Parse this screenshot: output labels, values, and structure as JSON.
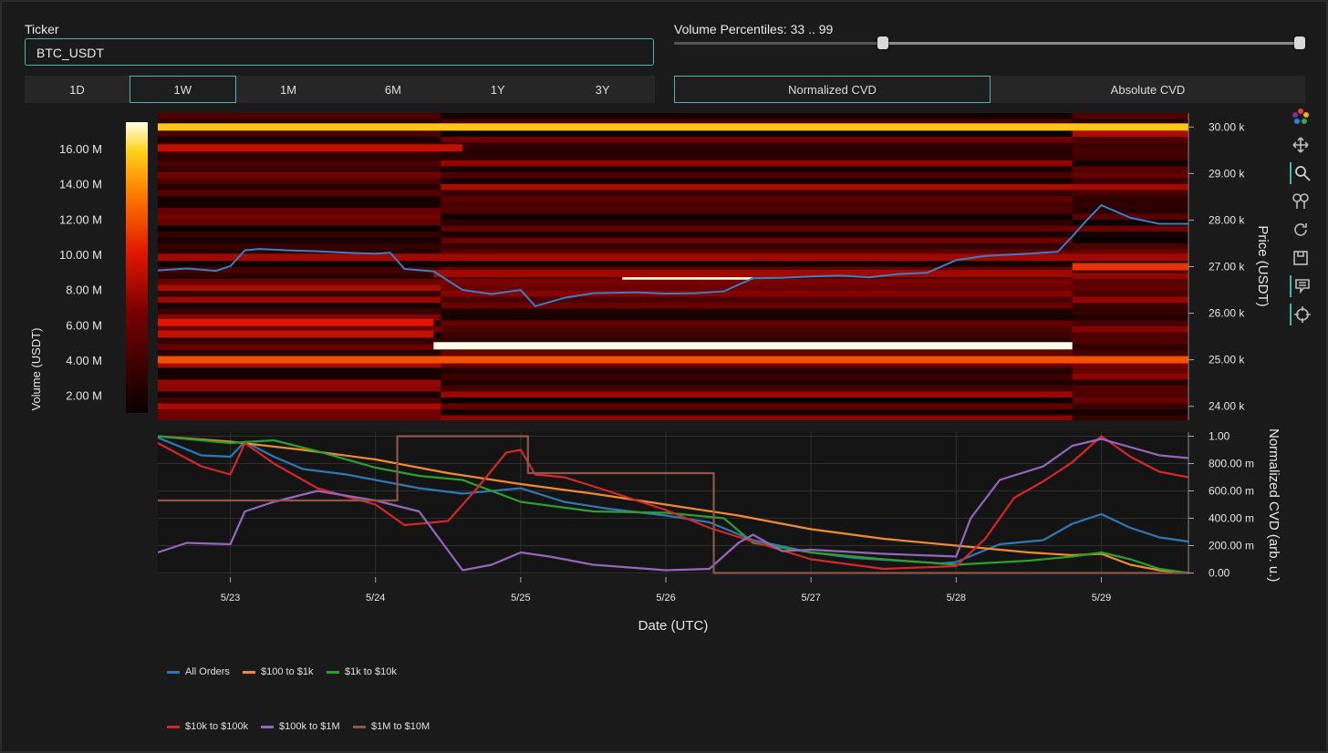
{
  "controls": {
    "ticker_label": "Ticker",
    "ticker_value": "BTC_USDT",
    "timeframes": [
      "1D",
      "1W",
      "1M",
      "6M",
      "1Y",
      "3Y"
    ],
    "active_timeframe": "1W",
    "volume_percentiles_label": "Volume Percentiles: 33 .. 99",
    "volume_percentiles_range": [
      33,
      99
    ],
    "cvd_modes": [
      "Normalized CVD",
      "Absolute CVD"
    ],
    "active_cvd_mode": "Normalized CVD"
  },
  "modebar": {
    "icons": [
      "plotly-logo-icon",
      "pan-icon",
      "zoom-icon",
      "zoom-in-out-icon",
      "reset-axes-icon",
      "download-icon",
      "hover-compare-icon",
      "spike-lines-icon"
    ]
  },
  "chart_data": [
    {
      "type": "heatmap",
      "colorbar": {
        "title": "Volume (USDT)",
        "ticks": [
          "2.00 M",
          "4.00 M",
          "6.00 M",
          "8.00 M",
          "10.00 M",
          "12.00 M",
          "14.00 M",
          "16.00 M"
        ],
        "tick_values": [
          2,
          4,
          6,
          8,
          10,
          12,
          14,
          16
        ],
        "range": [
          1,
          17.5
        ],
        "colorscale": "hot"
      },
      "yaxis": {
        "title": "Price (USDT)",
        "side": "right",
        "ticks": [
          "24.00 k",
          "25.00 k",
          "26.00 k",
          "27.00 k",
          "28.00 k",
          "29.00 k",
          "30.00 k"
        ],
        "tick_values": [
          24000,
          25000,
          26000,
          27000,
          28000,
          29000,
          30000
        ],
        "range": [
          23700,
          30300
        ]
      },
      "x_range_days": [
        22.5,
        29.6
      ],
      "notable_levels": [
        {
          "price": 30000,
          "volume_m": 15.5,
          "from": 22.5,
          "to": 29.6
        },
        {
          "price": 29550,
          "volume_m": 9,
          "from": 22.5,
          "to": 24.6
        },
        {
          "price": 26800,
          "volume_m": 17.5,
          "from": 25.7,
          "to": 26.6
        },
        {
          "price": 25300,
          "volume_m": 17.5,
          "from": 24.4,
          "to": 28.8
        },
        {
          "price": 25000,
          "volume_m": 12,
          "from": 22.5,
          "to": 29.6
        },
        {
          "price": 25800,
          "volume_m": 10,
          "from": 22.5,
          "to": 24.4
        },
        {
          "price": 25550,
          "volume_m": 9,
          "from": 22.5,
          "to": 24.4
        },
        {
          "price": 27000,
          "volume_m": 11,
          "from": 28.8,
          "to": 29.6
        },
        {
          "price": 26850,
          "volume_m": 8,
          "from": 24.4,
          "to": 28.8
        },
        {
          "price": 27200,
          "volume_m": 8,
          "from": 22.5,
          "to": 29.6
        }
      ],
      "price_series": {
        "name": "Price",
        "color": "#3b7fc4",
        "x": [
          22.5,
          22.7,
          22.9,
          23.0,
          23.1,
          23.2,
          23.4,
          23.6,
          23.8,
          24.0,
          24.1,
          24.2,
          24.4,
          24.6,
          24.8,
          25.0,
          25.1,
          25.3,
          25.5,
          25.8,
          26.0,
          26.2,
          26.4,
          26.6,
          26.8,
          27.0,
          27.2,
          27.4,
          27.6,
          27.8,
          28.0,
          28.2,
          28.5,
          28.7,
          28.8,
          28.9,
          29.0,
          29.2,
          29.4,
          29.6
        ],
        "y": [
          26920,
          26960,
          26910,
          27010,
          27350,
          27380,
          27350,
          27330,
          27300,
          27280,
          27300,
          26950,
          26900,
          26500,
          26410,
          26500,
          26150,
          26330,
          26430,
          26450,
          26420,
          26430,
          26470,
          26750,
          26760,
          26790,
          26810,
          26770,
          26840,
          26870,
          27140,
          27230,
          27280,
          27320,
          27650,
          28000,
          28320,
          28050,
          27920,
          27920
        ]
      }
    },
    {
      "type": "line",
      "xlabel": "Date (UTC)",
      "ylabel": "Normalized CVD (arb. u.)",
      "x_ticks": [
        "5/23",
        "5/24",
        "5/25",
        "5/26",
        "5/27",
        "5/28",
        "5/29"
      ],
      "x_tick_values": [
        23,
        24,
        25,
        26,
        27,
        28,
        29
      ],
      "x_range": [
        22.5,
        29.6
      ],
      "y_ticks": [
        "0.00",
        "200.00 m",
        "400.00 m",
        "600.00 m",
        "800.00 m",
        "1.00"
      ],
      "y_tick_values": [
        0,
        0.2,
        0.4,
        0.6,
        0.8,
        1.0
      ],
      "ylim": [
        -0.01,
        1.03
      ],
      "grid": true,
      "legend_placement": "bottom",
      "series": [
        {
          "name": "All Orders",
          "color": "#2f78b4",
          "x": [
            22.5,
            22.8,
            23.0,
            23.1,
            23.3,
            23.5,
            23.8,
            24.0,
            24.3,
            24.6,
            25.0,
            25.3,
            25.6,
            26.0,
            26.3,
            26.6,
            27.0,
            27.3,
            27.6,
            27.9,
            28.0,
            28.3,
            28.6,
            28.8,
            29.0,
            29.2,
            29.4,
            29.6
          ],
          "y": [
            0.99,
            0.86,
            0.85,
            0.96,
            0.85,
            0.76,
            0.72,
            0.68,
            0.62,
            0.58,
            0.62,
            0.52,
            0.47,
            0.42,
            0.37,
            0.24,
            0.15,
            0.11,
            0.09,
            0.07,
            0.08,
            0.21,
            0.24,
            0.36,
            0.43,
            0.33,
            0.26,
            0.23
          ]
        },
        {
          "name": "$100 to $1k",
          "color": "#f08c2f",
          "x": [
            22.5,
            23.0,
            23.5,
            24.0,
            24.5,
            25.0,
            25.5,
            26.0,
            26.5,
            27.0,
            27.5,
            28.0,
            28.5,
            28.8,
            29.0,
            29.2,
            29.4,
            29.6
          ],
          "y": [
            1.0,
            0.96,
            0.9,
            0.83,
            0.73,
            0.65,
            0.58,
            0.5,
            0.42,
            0.32,
            0.25,
            0.2,
            0.15,
            0.13,
            0.14,
            0.06,
            0.02,
            0.0
          ]
        },
        {
          "name": "$1k to $10k",
          "color": "#2ca02c",
          "x": [
            22.5,
            23.0,
            23.3,
            23.6,
            24.0,
            24.3,
            24.6,
            25.0,
            25.5,
            26.0,
            26.4,
            26.6,
            27.0,
            27.5,
            28.0,
            28.5,
            28.8,
            29.0,
            29.2,
            29.4,
            29.6
          ],
          "y": [
            1.0,
            0.95,
            0.97,
            0.89,
            0.77,
            0.71,
            0.68,
            0.52,
            0.45,
            0.44,
            0.4,
            0.22,
            0.15,
            0.1,
            0.06,
            0.09,
            0.12,
            0.15,
            0.1,
            0.03,
            0.0
          ]
        },
        {
          "name": "$10k to $100k",
          "color": "#d62728",
          "x": [
            22.5,
            22.8,
            23.0,
            23.1,
            23.3,
            23.6,
            24.0,
            24.2,
            24.5,
            24.7,
            24.9,
            25.0,
            25.1,
            25.3,
            25.6,
            26.0,
            26.3,
            26.6,
            27.0,
            27.5,
            28.0,
            28.2,
            28.4,
            28.6,
            28.8,
            29.0,
            29.2,
            29.4,
            29.6
          ],
          "y": [
            0.95,
            0.78,
            0.72,
            0.95,
            0.8,
            0.62,
            0.5,
            0.35,
            0.38,
            0.62,
            0.88,
            0.9,
            0.72,
            0.7,
            0.6,
            0.46,
            0.33,
            0.23,
            0.1,
            0.03,
            0.05,
            0.25,
            0.55,
            0.67,
            0.81,
            1.0,
            0.85,
            0.74,
            0.7
          ]
        },
        {
          "name": "$100k to $1M",
          "color": "#9467bd",
          "x": [
            22.5,
            22.7,
            23.0,
            23.1,
            23.3,
            23.6,
            24.0,
            24.3,
            24.6,
            24.8,
            25.0,
            25.2,
            25.5,
            26.0,
            26.3,
            26.5,
            26.6,
            26.8,
            27.0,
            27.5,
            28.0,
            28.1,
            28.3,
            28.6,
            28.8,
            29.0,
            29.2,
            29.4,
            29.6
          ],
          "y": [
            0.15,
            0.22,
            0.21,
            0.45,
            0.52,
            0.6,
            0.53,
            0.45,
            0.02,
            0.06,
            0.15,
            0.12,
            0.06,
            0.02,
            0.03,
            0.22,
            0.28,
            0.16,
            0.17,
            0.14,
            0.12,
            0.4,
            0.68,
            0.78,
            0.93,
            0.98,
            0.92,
            0.86,
            0.84
          ]
        },
        {
          "name": "$1M to $10M",
          "color": "#8c564b",
          "x": [
            22.5,
            24.15,
            24.15,
            25.05,
            25.05,
            26.33,
            26.33,
            29.6
          ],
          "y": [
            0.53,
            0.53,
            1.0,
            1.0,
            0.73,
            0.73,
            0.0,
            0.0
          ]
        }
      ]
    }
  ]
}
